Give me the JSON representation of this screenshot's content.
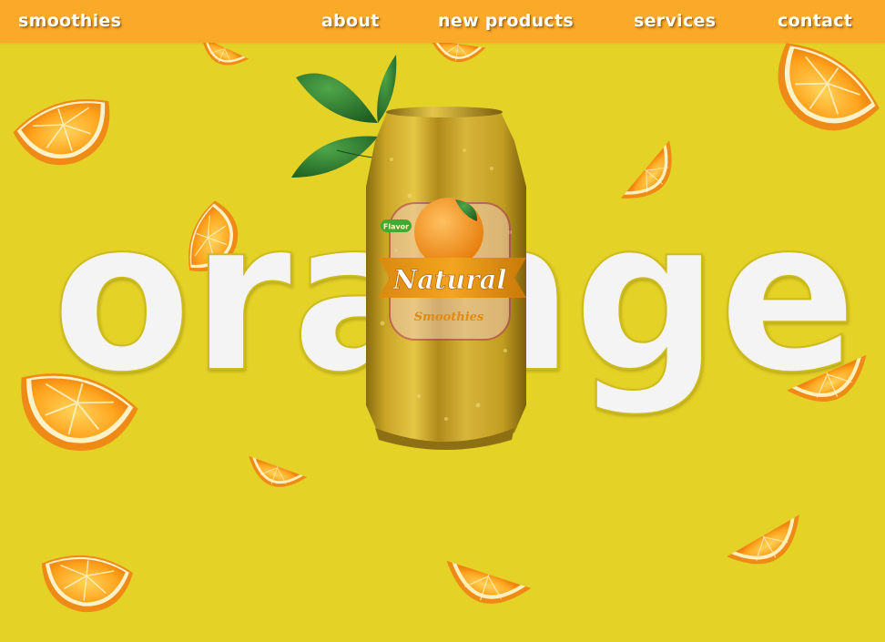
{
  "nav": {
    "logo": "smoothies",
    "links": [
      "about",
      "new products",
      "services",
      "contact"
    ]
  },
  "hero": {
    "headline": "orange"
  },
  "product": {
    "badge": "Flavor",
    "brand": "Natural",
    "subtitle": "Smoothies"
  },
  "colors": {
    "background": "#E4D227",
    "nav": "#FBA928",
    "headline": "#F4F4F4",
    "can": "#C9A524"
  }
}
